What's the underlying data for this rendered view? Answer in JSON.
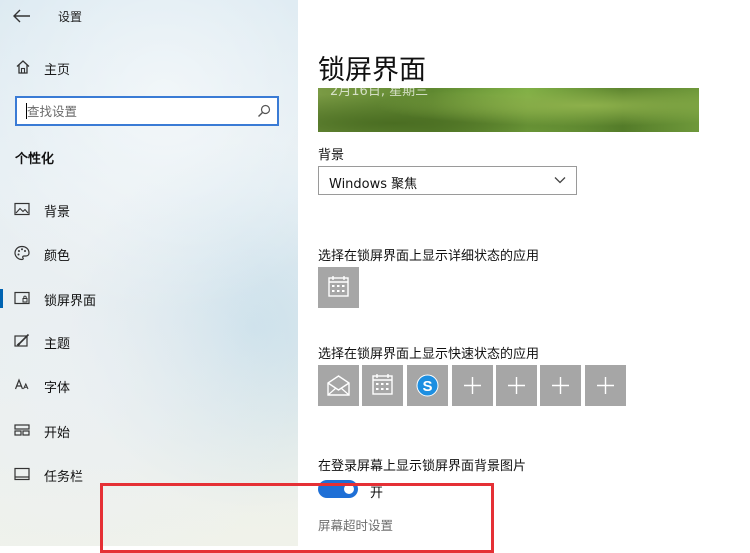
{
  "window": {
    "title": "设置"
  },
  "sidebar": {
    "home_label": "主页",
    "search": {
      "placeholder": "查找设置",
      "value": ""
    },
    "section_title": "个性化",
    "items": [
      {
        "label": "背景",
        "icon": "picture-icon"
      },
      {
        "label": "颜色",
        "icon": "palette-icon"
      },
      {
        "label": "锁屏界面",
        "icon": "lock-screen-icon",
        "selected": true
      },
      {
        "label": "主题",
        "icon": "theme-brush-icon"
      },
      {
        "label": "字体",
        "icon": "font-icon"
      },
      {
        "label": "开始",
        "icon": "start-layout-icon"
      },
      {
        "label": "任务栏",
        "icon": "taskbar-icon"
      }
    ]
  },
  "main": {
    "title": "锁屏界面",
    "preview_date": "2月16日, 星期三",
    "background_label": "背景",
    "background_value": "Windows 聚焦",
    "detailed_status_label": "选择在锁屏界面上显示详细状态的应用",
    "quick_status_label": "选择在锁屏界面上显示快速状态的应用",
    "signin_bg_label": "在登录屏幕上显示锁屏界面背景图片",
    "toggle_state": "开",
    "toggle_on": true,
    "timeout_link": "屏幕超时设置"
  },
  "colors": {
    "accent": "#0063b1",
    "toggle_on": "#1e6fd6",
    "tile": "#a6a6a6",
    "annotation": "#e53035"
  }
}
